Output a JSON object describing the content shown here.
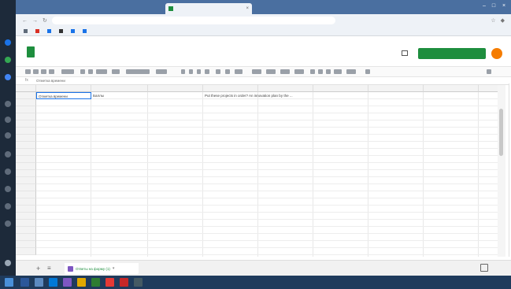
{
  "sheet": {
    "cells": {
      "A1": "Отметка времени",
      "B1": "Баллы",
      "D1": "Put these projects in order? An innovation plan by the ..."
    },
    "tab_label": "Ответы на форму (1)"
  },
  "colors": {
    "sheets_green": "#1e8e3e",
    "selection_blue": "#1a73e8",
    "avatar_orange": "#f57c00",
    "form_purple": "#7e57c2",
    "taskbar": "#1f3b5c"
  },
  "icons": [
    "back-icon",
    "forward-icon",
    "reload-icon",
    "sheets-logo-icon",
    "comments-icon",
    "add-sheet-icon",
    "all-sheets-icon",
    "form-icon",
    "explore-icon"
  ]
}
